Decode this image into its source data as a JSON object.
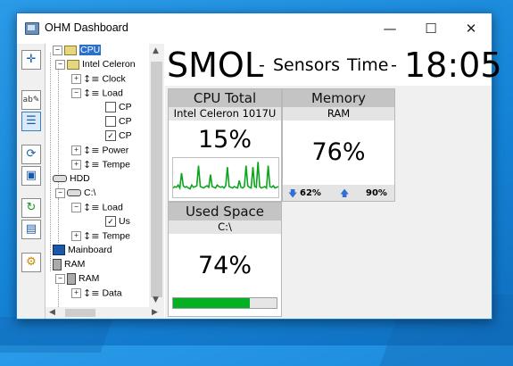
{
  "window": {
    "title": "OHM Dashboard"
  },
  "tree": {
    "items": [
      {
        "label": "CPU",
        "selected": true
      },
      {
        "label": "Intel Celeron"
      },
      {
        "label": "Clock"
      },
      {
        "label": "Load"
      },
      {
        "label": "CP"
      },
      {
        "label": "CP"
      },
      {
        "label": "CP",
        "checked": true
      },
      {
        "label": "Power"
      },
      {
        "label": "Tempe"
      },
      {
        "label": "HDD"
      },
      {
        "label": "C:\\"
      },
      {
        "label": "Load"
      },
      {
        "label": "Us",
        "checked": true
      },
      {
        "label": "Tempe"
      },
      {
        "label": "Mainboard"
      },
      {
        "label": "RAM"
      },
      {
        "label": "RAM"
      },
      {
        "label": "Data"
      }
    ]
  },
  "header": {
    "name": "SMOL",
    "sep1": "-",
    "sensors": "Sensors",
    "time_label": "Time",
    "sep2": "-",
    "time": "18:05"
  },
  "cards": {
    "cpu": {
      "title": "CPU Total",
      "subtitle": "Intel Celeron 1017U",
      "value": "15%",
      "history": [
        10,
        12,
        11,
        14,
        10,
        30,
        13,
        11,
        12,
        10,
        9,
        14,
        11,
        12,
        13,
        40,
        12,
        11,
        10,
        12,
        13,
        11,
        28,
        12,
        11,
        10,
        14,
        12,
        11,
        12,
        10,
        13,
        38,
        12,
        11,
        10,
        12,
        11,
        10,
        20,
        11,
        10,
        12,
        40,
        13,
        11,
        10,
        38,
        12,
        11,
        45,
        12,
        10,
        11,
        12,
        10,
        40,
        12,
        11,
        13,
        10,
        11,
        12
      ]
    },
    "memory": {
      "title": "Memory",
      "subtitle": "RAM",
      "value": "76%",
      "min": "62%",
      "max": "90%"
    },
    "used_space": {
      "title": "Used Space",
      "subtitle": "C:\\",
      "value": "74%",
      "fraction": 0.74
    }
  },
  "colors": {
    "graph_line": "#0aa51d",
    "accent": "#2b6fce",
    "bar": "#06b025"
  }
}
